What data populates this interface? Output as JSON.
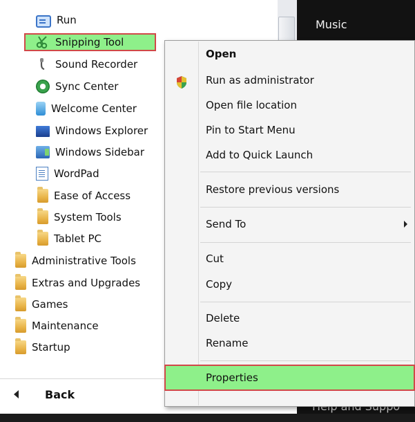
{
  "start_menu": {
    "programs": [
      {
        "label": "Run",
        "icon": "run-icon"
      },
      {
        "label": "Snipping Tool",
        "icon": "scissors-icon",
        "highlighted": true
      },
      {
        "label": "Sound Recorder",
        "icon": "microphone-icon"
      },
      {
        "label": "Sync Center",
        "icon": "sync-icon"
      },
      {
        "label": "Welcome Center",
        "icon": "welcome-icon"
      },
      {
        "label": "Windows Explorer",
        "icon": "explorer-icon"
      },
      {
        "label": "Windows Sidebar",
        "icon": "sidebar-icon"
      },
      {
        "label": "WordPad",
        "icon": "wordpad-icon"
      },
      {
        "label": "Ease of Access",
        "icon": "folder-icon"
      },
      {
        "label": "System Tools",
        "icon": "folder-icon"
      },
      {
        "label": "Tablet PC",
        "icon": "folder-icon"
      },
      {
        "label": "Administrative Tools",
        "icon": "folder-icon"
      },
      {
        "label": "Extras and Upgrades",
        "icon": "folder-icon"
      },
      {
        "label": "Games",
        "icon": "folder-icon"
      },
      {
        "label": "Maintenance",
        "icon": "folder-icon"
      },
      {
        "label": "Startup",
        "icon": "folder-icon"
      }
    ],
    "back_label": "Back"
  },
  "right_pane": {
    "music_label": "Music",
    "help_label": "Help and Suppo"
  },
  "context_menu": {
    "items": [
      {
        "label": "Open",
        "bold": true
      },
      {
        "label": "Run as administrator",
        "icon": "uac-shield-icon"
      },
      {
        "label": "Open file location"
      },
      {
        "label": "Pin to Start Menu"
      },
      {
        "label": "Add to Quick Launch"
      },
      {
        "label": "Restore previous versions"
      },
      {
        "label": "Send To",
        "submenu": true
      },
      {
        "label": "Cut"
      },
      {
        "label": "Copy"
      },
      {
        "label": "Delete"
      },
      {
        "label": "Rename"
      },
      {
        "label": "Properties",
        "highlighted": true
      }
    ]
  },
  "colors": {
    "highlight_green": "#8ef08a",
    "highlight_border": "#d04848",
    "dark_pane": "#121212"
  }
}
